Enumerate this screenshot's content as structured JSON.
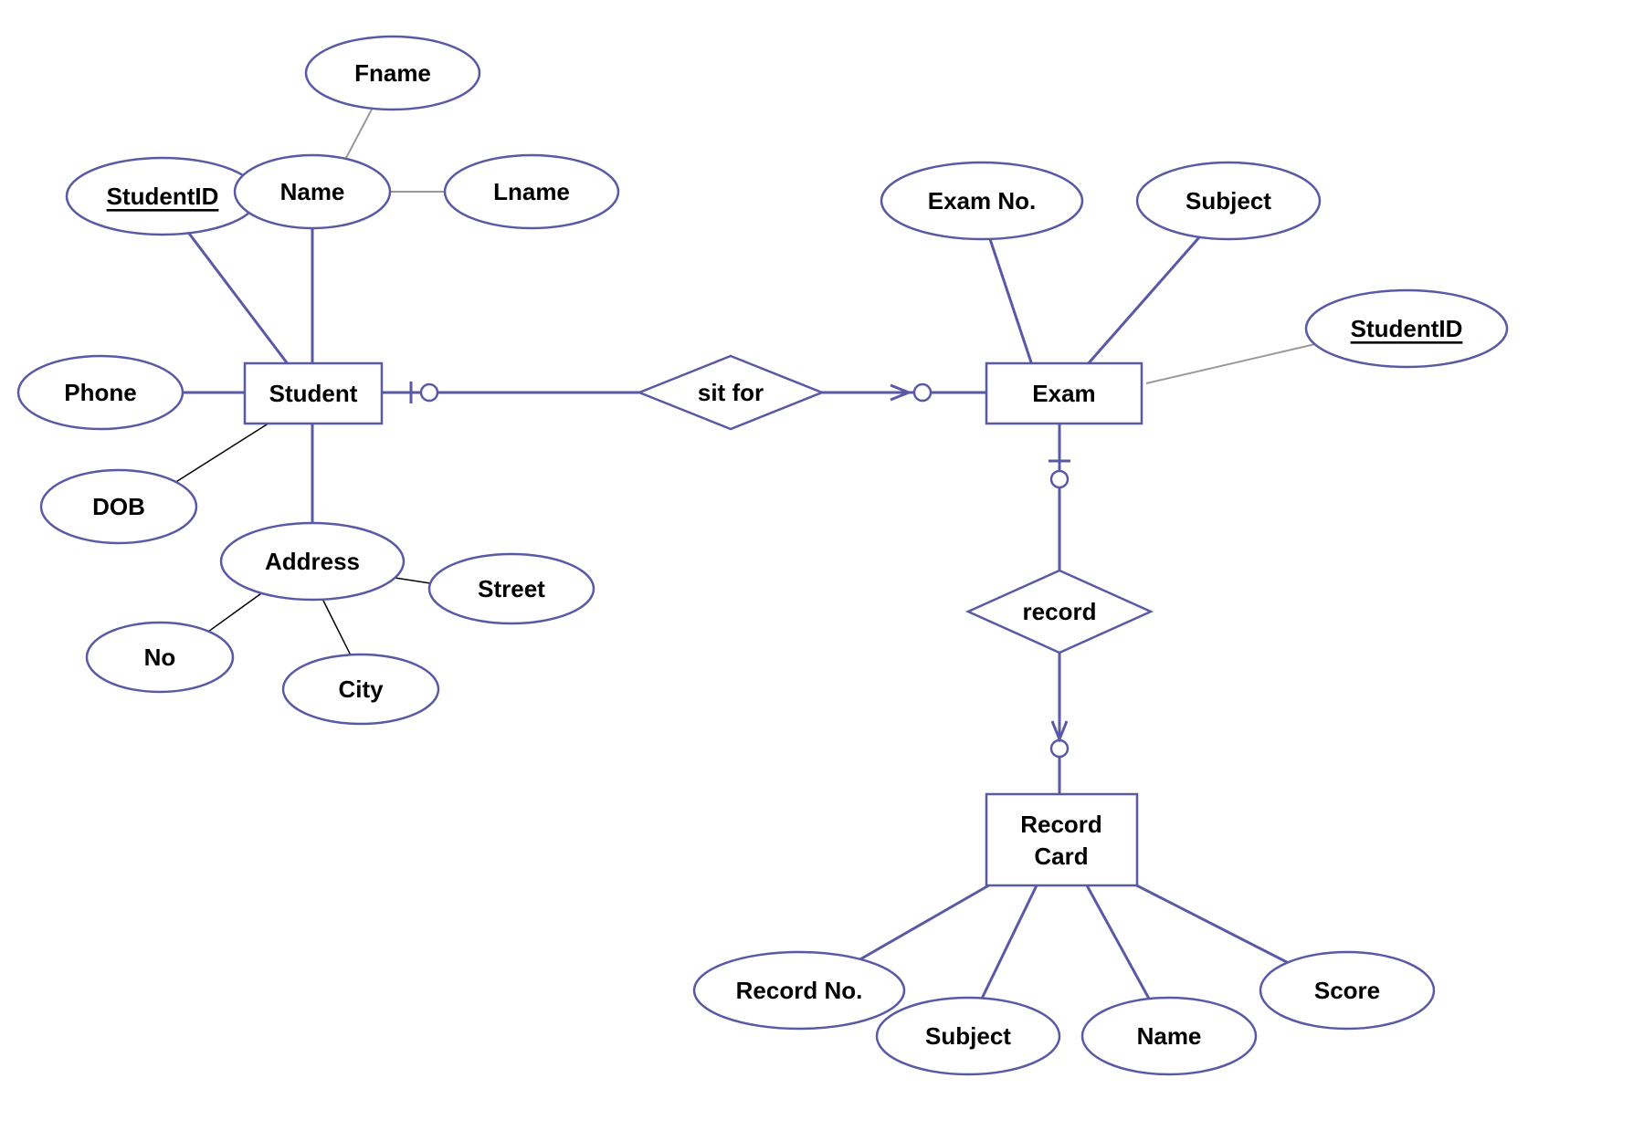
{
  "entities": {
    "student": "Student",
    "exam": "Exam",
    "record_card_l1": "Record",
    "record_card_l2": "Card"
  },
  "relationships": {
    "sit_for": "sit for",
    "record": "record"
  },
  "attributes": {
    "student_id": "StudentID",
    "name": "Name",
    "fname": "Fname",
    "lname": "Lname",
    "phone": "Phone",
    "dob": "DOB",
    "address": "Address",
    "no": "No",
    "city": "City",
    "street": "Street",
    "exam_no": "Exam No.",
    "subject_exam": "Subject",
    "exam_student_id": "StudentID",
    "record_no": "Record No.",
    "subject_rc": "Subject",
    "name_rc": "Name",
    "score": "Score"
  }
}
